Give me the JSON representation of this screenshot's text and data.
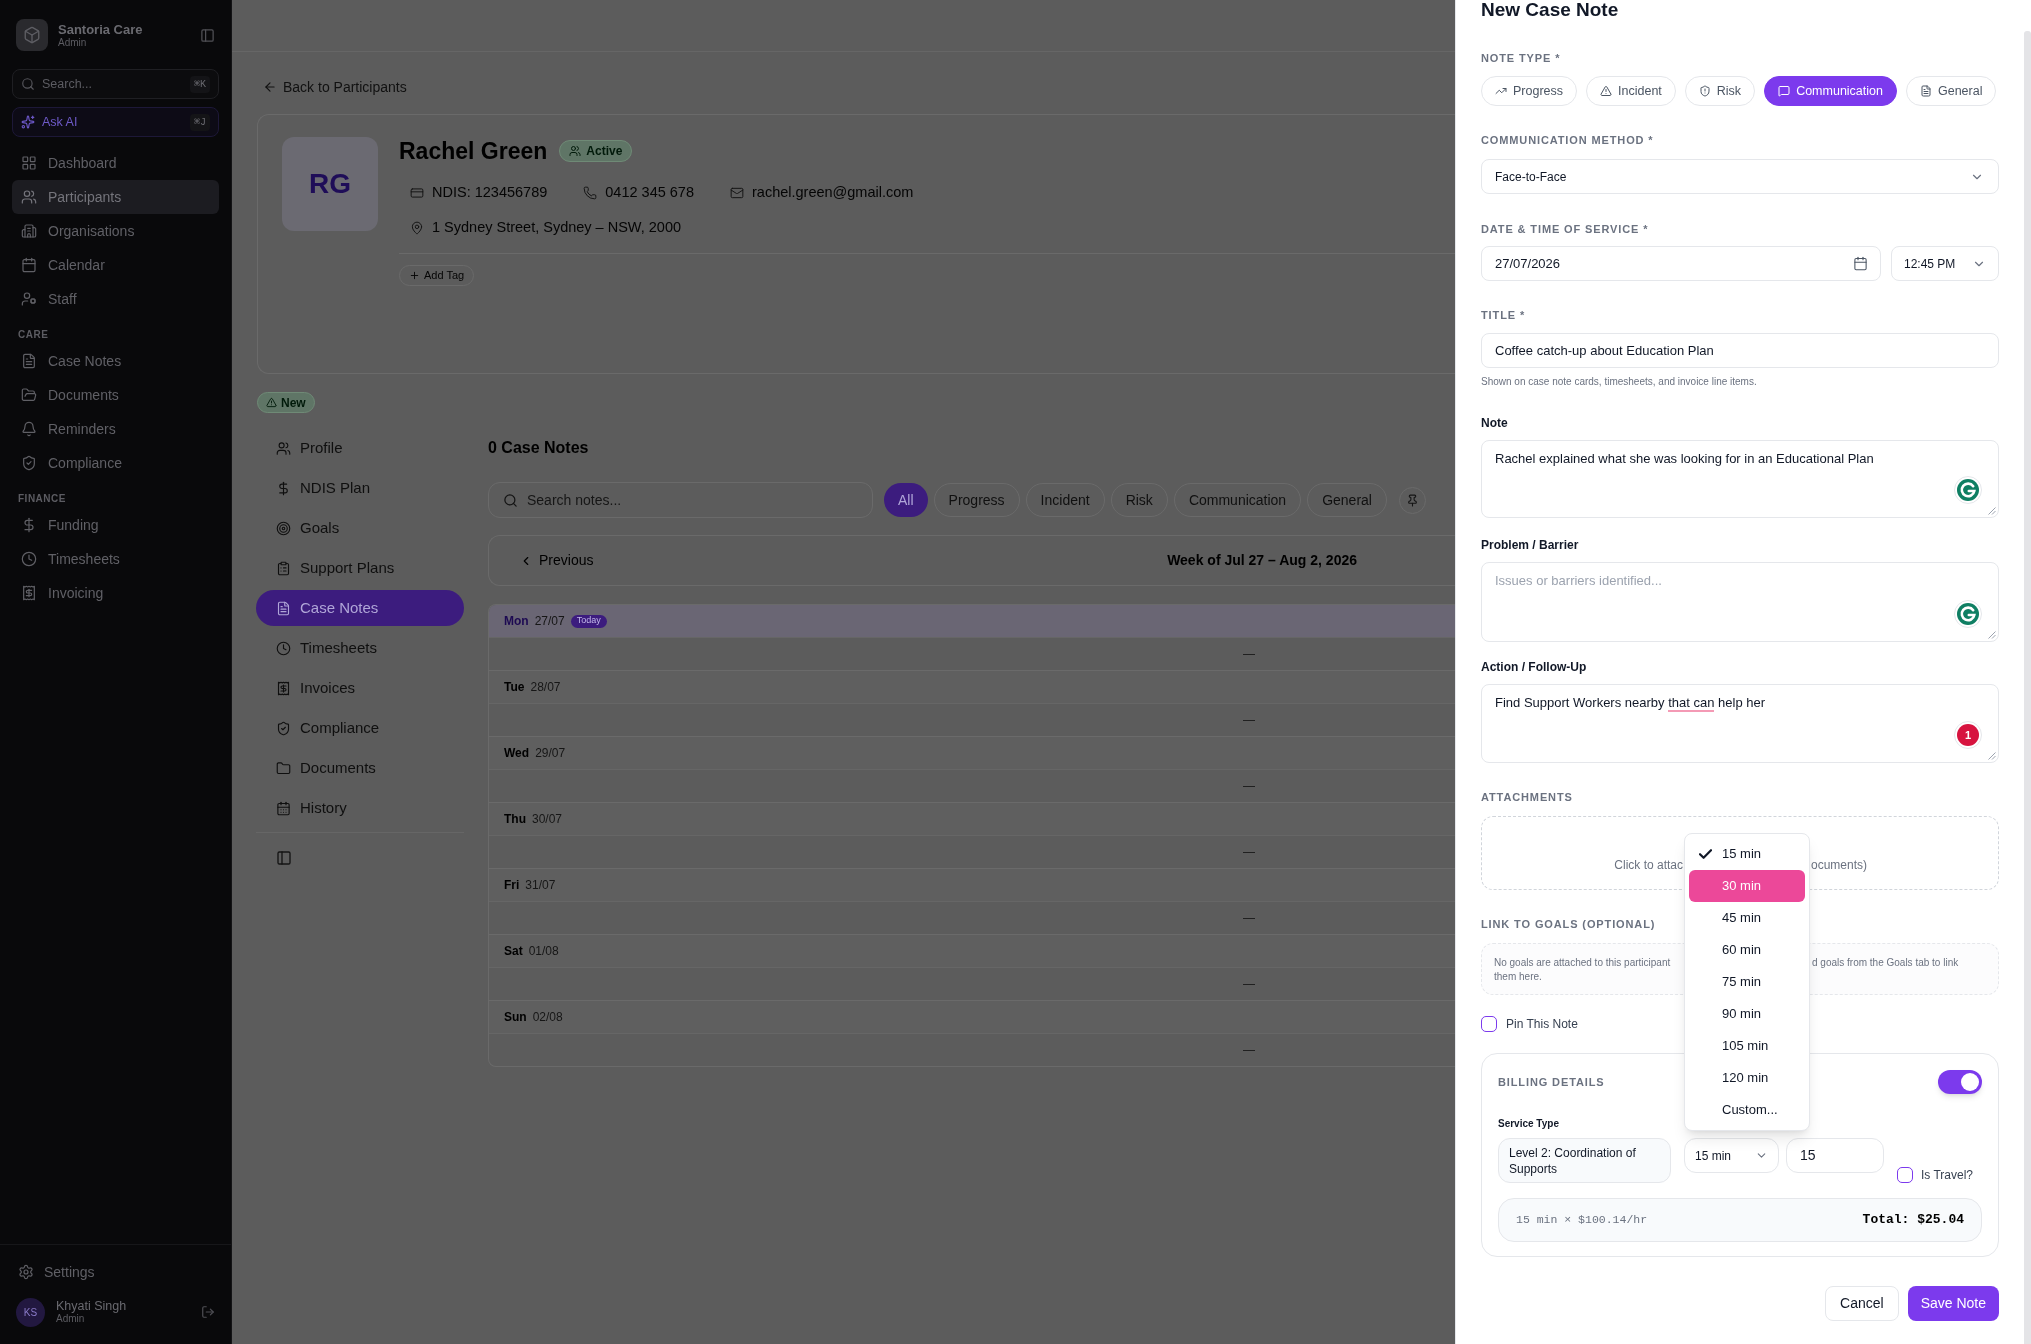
{
  "sidebar": {
    "brand": {
      "name": "Santoria Care",
      "role": "Admin"
    },
    "search": {
      "placeholder": "Search...",
      "shortcut": "⌘K"
    },
    "ask_ai": {
      "label": "Ask AI",
      "shortcut": "⌘J"
    },
    "items": [
      {
        "label": "Dashboard",
        "selected": false
      },
      {
        "label": "Participants",
        "selected": true
      },
      {
        "label": "Organisations",
        "selected": false
      },
      {
        "label": "Calendar",
        "selected": false
      },
      {
        "label": "Staff",
        "selected": false
      }
    ],
    "sections": [
      {
        "heading": "CARE",
        "items": [
          {
            "label": "Case Notes",
            "selected": false
          },
          {
            "label": "Documents",
            "selected": false
          },
          {
            "label": "Reminders",
            "selected": false
          },
          {
            "label": "Compliance",
            "selected": false
          }
        ]
      },
      {
        "heading": "FINANCE",
        "items": [
          {
            "label": "Funding",
            "selected": false
          },
          {
            "label": "Timesheets",
            "selected": false
          },
          {
            "label": "Invoicing",
            "selected": false
          }
        ]
      }
    ],
    "settings": {
      "label": "Settings"
    },
    "user": {
      "initials": "KS",
      "name": "Khyati Singh",
      "role": "Admin"
    }
  },
  "participant_page": {
    "back_link": "Back to Participants",
    "participant": {
      "initials": "RG",
      "name": "Rachel Green",
      "status": "Active",
      "details": [
        "NDIS: 123456789",
        "0412 345 678",
        "rachel.green@gmail.com"
      ],
      "address": "1 Sydney Street, Sydney – NSW, 2000",
      "add_tag": "Add Tag"
    },
    "alert_badge": "New",
    "tabs": [
      {
        "label": "Profile",
        "selected": false
      },
      {
        "label": "NDIS Plan",
        "selected": false
      },
      {
        "label": "Goals",
        "selected": false
      },
      {
        "label": "Support Plans",
        "selected": false
      },
      {
        "label": "Case Notes",
        "selected": true
      },
      {
        "label": "Timesheets",
        "selected": false
      },
      {
        "label": "Invoices",
        "selected": false
      },
      {
        "label": "Compliance",
        "selected": false
      },
      {
        "label": "Documents",
        "selected": false
      },
      {
        "label": "History",
        "selected": false
      }
    ],
    "case_notes": {
      "heading": "0 Case Notes",
      "search": {
        "placeholder": "Search notes..."
      },
      "filters": [
        {
          "label": "All",
          "selected": true
        },
        {
          "label": "Progress",
          "selected": false
        },
        {
          "label": "Incident",
          "selected": false
        },
        {
          "label": "Risk",
          "selected": false
        },
        {
          "label": "Communication",
          "selected": false
        },
        {
          "label": "General",
          "selected": false
        }
      ],
      "week": {
        "previous": "Previous",
        "label": "Week of Jul 27 – Aug 2, 2026"
      },
      "days": [
        {
          "day": "Mon",
          "date": "27/07",
          "today": true,
          "badge": "Today",
          "empty_marker": "—"
        },
        {
          "day": "Tue",
          "date": "28/07",
          "today": false,
          "empty_marker": "—"
        },
        {
          "day": "Wed",
          "date": "29/07",
          "today": false,
          "empty_marker": "—"
        },
        {
          "day": "Thu",
          "date": "30/07",
          "today": false,
          "empty_marker": "—"
        },
        {
          "day": "Fri",
          "date": "31/07",
          "today": false,
          "empty_marker": "—"
        },
        {
          "day": "Sat",
          "date": "01/08",
          "today": false,
          "empty_marker": "—"
        },
        {
          "day": "Sun",
          "date": "02/08",
          "today": false,
          "empty_marker": "—"
        }
      ]
    }
  },
  "case_note_form": {
    "title": "New Case Note",
    "note_type": {
      "label": "NOTE TYPE *",
      "options": [
        {
          "label": "Progress",
          "selected": false
        },
        {
          "label": "Incident",
          "selected": false
        },
        {
          "label": "Risk",
          "selected": false
        },
        {
          "label": "Communication",
          "selected": true
        },
        {
          "label": "General",
          "selected": false
        }
      ]
    },
    "communication_method": {
      "label": "COMMUNICATION METHOD *",
      "value": "Face-to-Face"
    },
    "date_time": {
      "label": "DATE & TIME OF SERVICE *",
      "date": "27/07/2026",
      "time": "12:45 PM"
    },
    "title_field": {
      "label": "TITLE *",
      "value": "Coffee catch-up about Education Plan",
      "hint": "Shown on case note cards, timesheets, and invoice line items."
    },
    "note": {
      "label": "Note",
      "value": "Rachel explained what she was looking for in an Educational Plan",
      "checker": {
        "kind": "ok"
      }
    },
    "problem": {
      "label": "Problem / Barrier",
      "placeholder": "Issues or barriers identified...",
      "checker": {
        "kind": "ok"
      }
    },
    "action": {
      "label": "Action / Follow-Up",
      "value_parts": [
        {
          "text": "Find Support Workers nearby ",
          "flagged": false
        },
        {
          "text": "that can",
          "flagged": true
        },
        {
          "text": " help her",
          "flagged": false
        }
      ],
      "checker": {
        "kind": "issues",
        "count": "1"
      }
    },
    "attachments": {
      "label": "ATTACHMENTS",
      "hint_start": "Click to attac",
      "hint_end": "ocuments)"
    },
    "goals": {
      "label": "LINK TO GOALS (OPTIONAL)",
      "text_start": "No goals are attached to this participant",
      "text_end": "d goals from the Goals tab to link",
      "text_line_2": "them here."
    },
    "pin": {
      "label": "Pin This Note",
      "checked": false
    },
    "billing": {
      "label": "BILLING DETAILS",
      "on": true,
      "service_type_label": "Service Type",
      "service_type": "Level 2: Coordination of Supports",
      "duration": "15 min",
      "minutes": "15",
      "travel": {
        "label": "Is Travel?",
        "checked": false
      },
      "calculation": "15 min × $100.14/hr",
      "total": "Total: $25.04"
    },
    "duration_menu": {
      "options": [
        {
          "label": "15 min",
          "selected": true,
          "highlighted": false
        },
        {
          "label": "30 min",
          "selected": false,
          "highlighted": true
        },
        {
          "label": "45 min",
          "selected": false,
          "highlighted": false
        },
        {
          "label": "60 min",
          "selected": false,
          "highlighted": false
        },
        {
          "label": "75 min",
          "selected": false,
          "highlighted": false
        },
        {
          "label": "90 min",
          "selected": false,
          "highlighted": false
        },
        {
          "label": "105 min",
          "selected": false,
          "highlighted": false
        },
        {
          "label": "120 min",
          "selected": false,
          "highlighted": false
        },
        {
          "label": "Custom...",
          "selected": false,
          "highlighted": false
        }
      ]
    },
    "actions": [
      {
        "label": "Cancel",
        "kind": "secondary"
      },
      {
        "label": "Save Note",
        "kind": "primary"
      }
    ]
  }
}
